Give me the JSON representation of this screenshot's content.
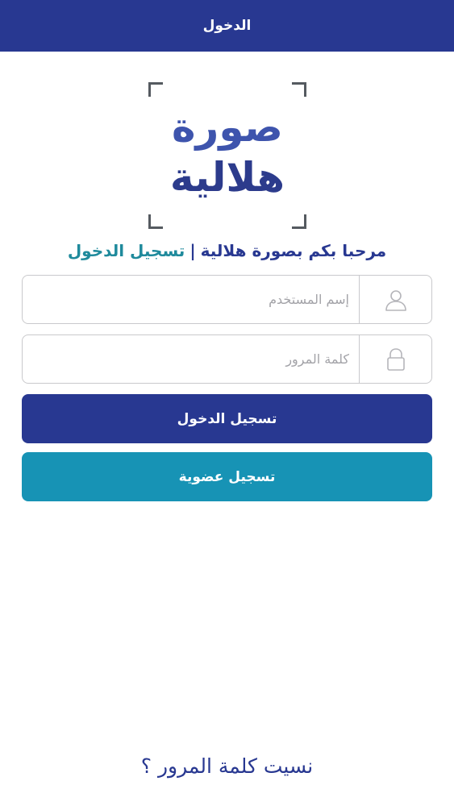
{
  "header": {
    "title": "الدخول"
  },
  "logo": {
    "line1": "صورة",
    "line2": "هلالية"
  },
  "welcome": {
    "greeting": "مرحبا بكم بصورة هلالية",
    "separator": "|",
    "action": "تسجيل الدخول"
  },
  "form": {
    "username": {
      "placeholder": "إسم المستخدم",
      "value": "",
      "icon": "user-icon"
    },
    "password": {
      "placeholder": "كلمة المرور",
      "value": "",
      "icon": "lock-icon"
    }
  },
  "buttons": {
    "login_label": "تسجيل الدخول",
    "register_label": "تسجيل عضوية"
  },
  "forgot_password": "نسيت كلمة المرور ؟",
  "colors": {
    "primary": "#283891",
    "secondary": "#1793b5",
    "accent_text": "#1f8a9c"
  }
}
